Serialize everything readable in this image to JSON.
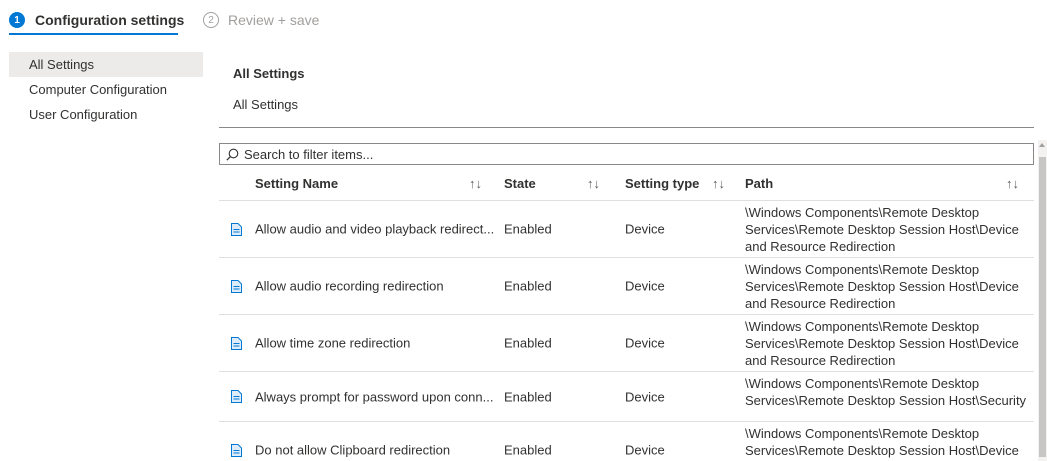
{
  "wizard": {
    "steps": [
      {
        "number": "1",
        "label": "Configuration settings",
        "active": true
      },
      {
        "number": "2",
        "label": "Review + save",
        "active": false
      }
    ]
  },
  "leftnav": {
    "items": [
      {
        "label": "All Settings",
        "active": true
      },
      {
        "label": "Computer Configuration",
        "active": false
      },
      {
        "label": "User Configuration",
        "active": false
      }
    ]
  },
  "main": {
    "title": "All Settings",
    "subtitle": "All Settings"
  },
  "search": {
    "placeholder": "Search to filter items...",
    "icon": "search-icon"
  },
  "table": {
    "columns": [
      {
        "label": "Setting Name",
        "sort": "↑↓"
      },
      {
        "label": "State",
        "sort": "↑↓"
      },
      {
        "label": "Setting type",
        "sort": "↑↓"
      },
      {
        "label": "Path",
        "sort": "↑↓"
      }
    ],
    "rows": [
      {
        "icon": "document-icon",
        "name": "Allow audio and video playback redirect...",
        "state": "Enabled",
        "type": "Device",
        "path": "\\Windows Components\\Remote Desktop Services\\Remote Desktop Session Host\\Device and Resource Redirection"
      },
      {
        "icon": "document-icon",
        "name": "Allow audio recording redirection",
        "state": "Enabled",
        "type": "Device",
        "path": "\\Windows Components\\Remote Desktop Services\\Remote Desktop Session Host\\Device and Resource Redirection"
      },
      {
        "icon": "document-icon",
        "name": "Allow time zone redirection",
        "state": "Enabled",
        "type": "Device",
        "path": "\\Windows Components\\Remote Desktop Services\\Remote Desktop Session Host\\Device and Resource Redirection"
      },
      {
        "icon": "document-icon",
        "name": "Always prompt for password upon conn...",
        "state": "Enabled",
        "type": "Device",
        "path": "\\Windows Components\\Remote Desktop Services\\Remote Desktop Session Host\\Security"
      },
      {
        "icon": "document-icon",
        "name": "Do not allow Clipboard redirection",
        "state": "Enabled",
        "type": "Device",
        "path": "\\Windows Components\\Remote Desktop Services\\Remote Desktop Session Host\\Device and Resource Redirection"
      }
    ]
  },
  "colors": {
    "accent": "#0078d4",
    "text": "#323130",
    "muted": "#a19f9d",
    "nav_active_bg": "#edebe9"
  }
}
